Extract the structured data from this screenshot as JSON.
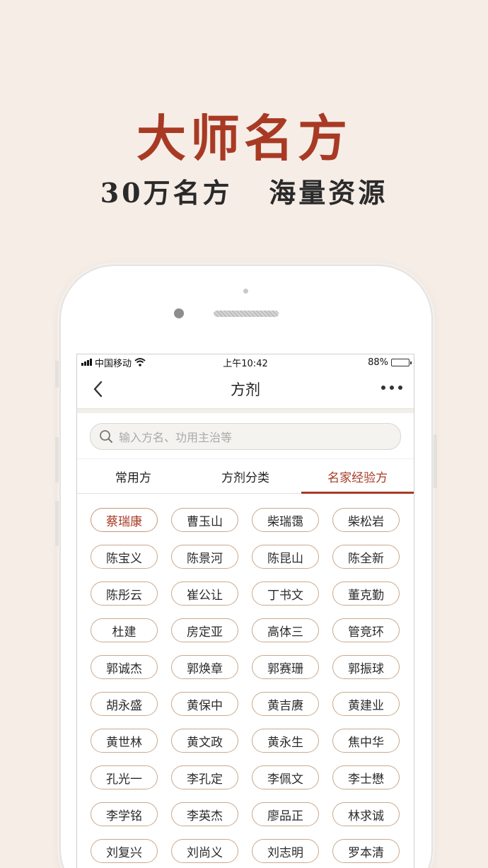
{
  "promo": {
    "headline": "大师名方",
    "subline": "30万名方   海量资源"
  },
  "status": {
    "carrier": "中国移动",
    "time": "上午10:42",
    "battery": "88%",
    "battery_level": 0.88
  },
  "nav": {
    "title": "方剂"
  },
  "search": {
    "placeholder": "输入方名、功用主治等"
  },
  "tabs": [
    "常用方",
    "方剂分类",
    "名家经验方"
  ],
  "active_tab": 2,
  "names": [
    "蔡瑞康",
    "曹玉山",
    "柴瑞霭",
    "柴松岩",
    "陈宝义",
    "陈景河",
    "陈昆山",
    "陈全新",
    "陈彤云",
    "崔公让",
    "丁书文",
    "董克勤",
    "杜建",
    "房定亚",
    "高体三",
    "管竞环",
    "郭诚杰",
    "郭焕章",
    "郭赛珊",
    "郭振球",
    "胡永盛",
    "黄保中",
    "黄吉赓",
    "黄建业",
    "黄世林",
    "黄文政",
    "黄永生",
    "焦中华",
    "孔光一",
    "李孔定",
    "李佩文",
    "李士懋",
    "李学铭",
    "李英杰",
    "廖品正",
    "林求诚",
    "刘复兴",
    "刘尚义",
    "刘志明",
    "罗本清"
  ],
  "active_name": 0,
  "colors": {
    "accent": "#a83a24",
    "background": "#f6ede7",
    "pill_border": "#c9a98c"
  }
}
